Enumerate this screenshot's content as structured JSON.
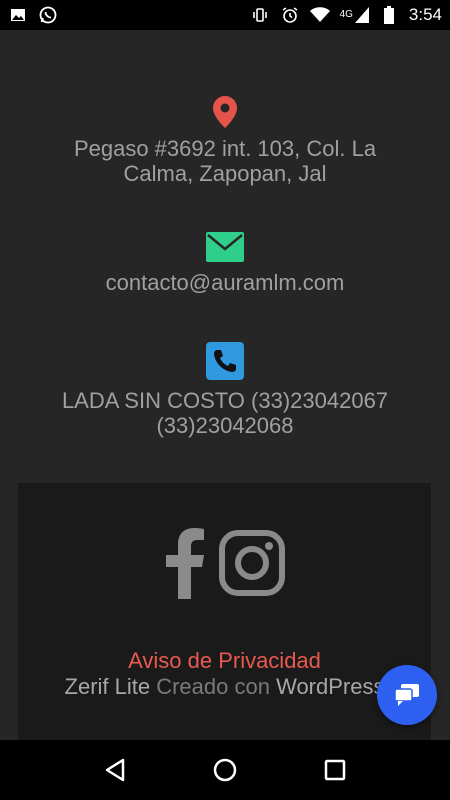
{
  "status_bar": {
    "time": "3:54",
    "network": "4G",
    "left_icons": [
      "image-icon",
      "whatsapp-icon"
    ],
    "right_icons": [
      "vibrate-icon",
      "alarm-icon",
      "wifi-icon",
      "signal-icon",
      "battery-icon"
    ]
  },
  "contact": {
    "address": {
      "icon": "location-pin-icon",
      "icon_color": "#e5544a",
      "line1": "Pegaso #3692 int. 103, Col. La",
      "line2": "Calma, Zapopan, Jal"
    },
    "email": {
      "icon": "envelope-icon",
      "icon_color": "#2fcf8b",
      "text": "contacto@auramlm.com"
    },
    "phone": {
      "icon": "phone-icon",
      "icon_color": "#2f9ae0",
      "line1": "LADA SIN COSTO (33)23042067",
      "line2": "(33)23042068"
    }
  },
  "footer": {
    "social_icons": [
      "facebook-icon",
      "instagram-icon"
    ],
    "privacy_label": "Aviso de Privacidad",
    "credits": {
      "theme": "Zerif Lite",
      "created_with": " Creado con ",
      "platform": "WordPress"
    }
  },
  "chat_fab": {
    "icon": "chat-bubbles-icon",
    "color": "#2d5ff0"
  },
  "nav_bar": {
    "buttons": [
      "back-icon",
      "home-icon",
      "recents-icon"
    ]
  }
}
